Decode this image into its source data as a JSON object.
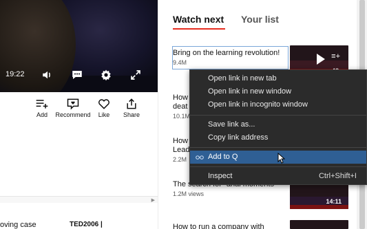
{
  "player": {
    "time": "19:22",
    "icons": [
      "volume-icon",
      "captions-icon",
      "settings-icon",
      "fullscreen-icon"
    ]
  },
  "actions": [
    {
      "label": "Add",
      "icon": "add-to-list-icon"
    },
    {
      "label": "Recommend",
      "icon": "recommend-icon"
    },
    {
      "label": "Like",
      "icon": "heart-icon"
    },
    {
      "label": "Share",
      "icon": "share-icon"
    }
  ],
  "left_footer": {
    "text": "oving case",
    "tag": "TED2006"
  },
  "tabs": {
    "active": "Watch next",
    "inactive": "Your list"
  },
  "watch_next": [
    {
      "title": "Bring on the learning revolution!",
      "views": "9.4M"
    },
    {
      "title": "How",
      "subtitle": "deat",
      "views": "10.1M"
    },
    {
      "title": "How",
      "subtitle": "Lead",
      "views": "2.2M"
    },
    {
      "title": "The search for \"anal moments",
      "views": "1.2M views",
      "duration": "14:11"
    },
    {
      "title": "How to run a company with"
    }
  ],
  "thumbnail_overlay": {
    "queue_count": "48"
  },
  "context_menu": {
    "items": [
      {
        "label": "Open link in new tab"
      },
      {
        "label": "Open link in new window"
      },
      {
        "label": "Open link in incognito window"
      },
      {
        "label": "Save link as..."
      },
      {
        "label": "Copy link address"
      },
      {
        "label": "Add to Q",
        "icon": "glasses-icon",
        "highlighted": true
      },
      {
        "label": "Inspect",
        "shortcut": "Ctrl+Shift+I"
      }
    ]
  },
  "colors": {
    "accent_red": "#e62b1e",
    "menu_bg": "#2b2b2b",
    "menu_highlight": "#2f5f94"
  }
}
